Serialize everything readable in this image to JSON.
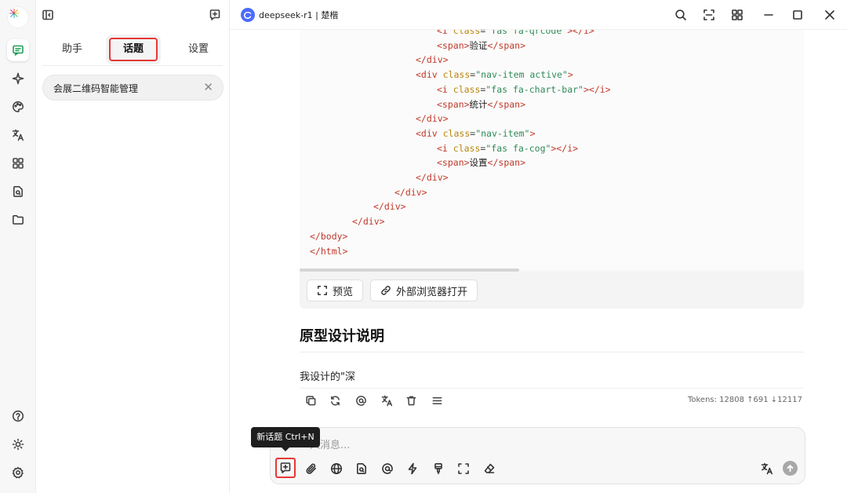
{
  "sidebar": {
    "tabs": [
      {
        "label": "助手"
      },
      {
        "label": "话题"
      },
      {
        "label": "设置"
      }
    ],
    "topic": {
      "label": "会展二维码智能管理",
      "close": "✕"
    }
  },
  "titlebar": {
    "model": "deepseek-r1 | 楚楷"
  },
  "code": {
    "lines": [
      {
        "indent": 6,
        "parts": [
          [
            "tagc",
            "<i "
          ],
          [
            "attrc",
            "class"
          ],
          [
            "punc",
            "="
          ],
          [
            "strc",
            "\"fas fa-qrcode\""
          ],
          [
            "tagc",
            "></i>"
          ]
        ]
      },
      {
        "indent": 6,
        "parts": [
          [
            "tagc",
            "<span>"
          ],
          [
            "txtc",
            "验证"
          ],
          [
            "tagc",
            "</span>"
          ]
        ]
      },
      {
        "indent": 5,
        "parts": [
          [
            "tagc",
            "</div>"
          ]
        ]
      },
      {
        "indent": 5,
        "parts": [
          [
            "tagc",
            "<div "
          ],
          [
            "attrc",
            "class"
          ],
          [
            "punc",
            "="
          ],
          [
            "strc",
            "\"nav-item active\""
          ],
          [
            "tagc",
            ">"
          ]
        ]
      },
      {
        "indent": 6,
        "parts": [
          [
            "tagc",
            "<i "
          ],
          [
            "attrc",
            "class"
          ],
          [
            "punc",
            "="
          ],
          [
            "strc",
            "\"fas fa-chart-bar\""
          ],
          [
            "tagc",
            "></i>"
          ]
        ]
      },
      {
        "indent": 6,
        "parts": [
          [
            "tagc",
            "<span>"
          ],
          [
            "txtc",
            "统计"
          ],
          [
            "tagc",
            "</span>"
          ]
        ]
      },
      {
        "indent": 5,
        "parts": [
          [
            "tagc",
            "</div>"
          ]
        ]
      },
      {
        "indent": 5,
        "parts": [
          [
            "tagc",
            "<div "
          ],
          [
            "attrc",
            "class"
          ],
          [
            "punc",
            "="
          ],
          [
            "strc",
            "\"nav-item\""
          ],
          [
            "tagc",
            ">"
          ]
        ]
      },
      {
        "indent": 6,
        "parts": [
          [
            "tagc",
            "<i "
          ],
          [
            "attrc",
            "class"
          ],
          [
            "punc",
            "="
          ],
          [
            "strc",
            "\"fas fa-cog\""
          ],
          [
            "tagc",
            "></i>"
          ]
        ]
      },
      {
        "indent": 6,
        "parts": [
          [
            "tagc",
            "<span>"
          ],
          [
            "txtc",
            "设置"
          ],
          [
            "tagc",
            "</span>"
          ]
        ]
      },
      {
        "indent": 5,
        "parts": [
          [
            "tagc",
            "</div>"
          ]
        ]
      },
      {
        "indent": 4,
        "parts": [
          [
            "tagc",
            "</div>"
          ]
        ]
      },
      {
        "indent": 3,
        "parts": [
          [
            "tagc",
            "</div>"
          ]
        ]
      },
      {
        "indent": 2,
        "parts": [
          [
            "tagc",
            "</div>"
          ]
        ]
      },
      {
        "indent": 0,
        "parts": [
          [
            "tagc",
            "</body>"
          ]
        ]
      },
      {
        "indent": 0,
        "parts": [
          [
            "tagc",
            "</html>"
          ]
        ]
      }
    ],
    "preview_label": "预览",
    "open_browser_label": "外部浏览器打开"
  },
  "message": {
    "heading": "原型设计说明",
    "text": "我设计的\"深",
    "tokens": "Tokens: 12808 ↑691 ↓12117"
  },
  "input": {
    "placeholder": "入消息...",
    "tooltip": "新话题 Ctrl+N"
  }
}
